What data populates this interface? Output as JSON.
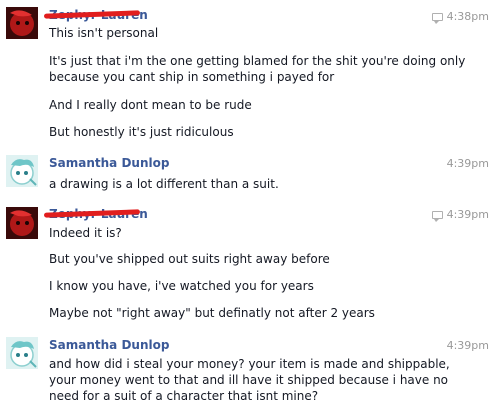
{
  "messages": [
    {
      "sender": "Zephyr Lauren",
      "time": "4:38pm",
      "lines": [
        "This isn't personal",
        "It's just that i'm the one getting blamed for the shit you're doing only because you cant ship in something i payed for",
        "And I really dont mean to be rude",
        "But honestly it's just ridiculous"
      ]
    },
    {
      "sender": "Samantha Dunlop",
      "time": "4:39pm",
      "lines": [
        "a drawing is a lot different than a suit."
      ]
    },
    {
      "sender": "Zephyr Lauren",
      "time": "4:39pm",
      "lines": [
        "Indeed it is?",
        "But you've shipped out suits right away before",
        "I know you have, i've watched you for years",
        "Maybe not \"right away\" but definatly not after 2 years"
      ]
    },
    {
      "sender": "Samantha Dunlop",
      "time": "4:39pm",
      "lines": [
        "and how did i steal your money? your item is made and shippable, your money went to that and ill have it shipped because i have no need for a suit of a character that isnt mine?"
      ]
    }
  ],
  "colors": {
    "sender": "#3b5998",
    "text": "#141823",
    "time": "#999999",
    "redaction": "#e11e1e"
  }
}
